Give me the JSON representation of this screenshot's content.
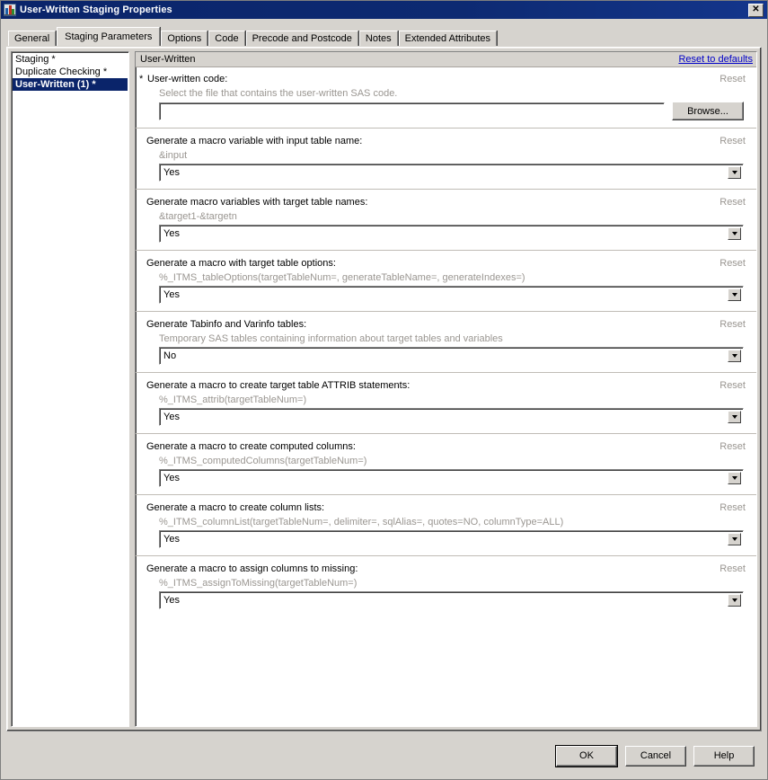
{
  "window": {
    "title": "User-Written Staging Properties",
    "icon": "application-window-icon",
    "close_label": "✕"
  },
  "tabs": [
    {
      "label": "General",
      "selected": false
    },
    {
      "label": "Staging Parameters",
      "selected": true
    },
    {
      "label": "Options",
      "selected": false
    },
    {
      "label": "Code",
      "selected": false
    },
    {
      "label": "Precode and Postcode",
      "selected": false
    },
    {
      "label": "Notes",
      "selected": false
    },
    {
      "label": "Extended Attributes",
      "selected": false
    }
  ],
  "left_list": [
    {
      "label": "Staging *",
      "selected": false
    },
    {
      "label": "Duplicate Checking *",
      "selected": false
    },
    {
      "label": "User-Written (1) *",
      "selected": true
    }
  ],
  "panel": {
    "title": "User-Written",
    "reset_to_defaults": "Reset to defaults",
    "reset_label": "Reset"
  },
  "sections": [
    {
      "type": "file",
      "required": true,
      "star": "*",
      "label": "User-written code:",
      "reset": "Reset",
      "hint": "Select the file that contains the user-written SAS code.",
      "value": "",
      "placeholder": "",
      "browse_label": "Browse..."
    },
    {
      "type": "combo",
      "required": false,
      "label": "Generate a macro variable with input table name:",
      "reset": "Reset",
      "hint": "&input",
      "value": "Yes"
    },
    {
      "type": "combo",
      "required": false,
      "label": "Generate macro variables with target table names:",
      "reset": "Reset",
      "hint": "&target1-&targetn",
      "value": "Yes"
    },
    {
      "type": "combo",
      "required": false,
      "label": "Generate a macro with target table options:",
      "reset": "Reset",
      "hint": "%_ITMS_tableOptions(targetTableNum=, generateTableName=, generateIndexes=)",
      "value": "Yes"
    },
    {
      "type": "combo",
      "required": false,
      "label": "Generate Tabinfo and Varinfo tables:",
      "reset": "Reset",
      "hint": "Temporary SAS tables containing information about target tables and variables",
      "value": "No"
    },
    {
      "type": "combo",
      "required": false,
      "label": "Generate a macro to create target table ATTRIB statements:",
      "reset": "Reset",
      "hint": "%_ITMS_attrib(targetTableNum=)",
      "value": "Yes"
    },
    {
      "type": "combo",
      "required": false,
      "label": "Generate a macro to create computed columns:",
      "reset": "Reset",
      "hint": "%_ITMS_computedColumns(targetTableNum=)",
      "value": "Yes"
    },
    {
      "type": "combo",
      "required": false,
      "label": "Generate a macro to create column lists:",
      "reset": "Reset",
      "hint": "%_ITMS_columnList(targetTableNum=, delimiter=, sqlAlias=, quotes=NO, columnType=ALL)",
      "value": "Yes"
    },
    {
      "type": "combo",
      "required": false,
      "label": "Generate a macro to assign columns to missing:",
      "reset": "Reset",
      "hint": "%_ITMS_assignToMissing(targetTableNum=)",
      "value": "Yes"
    }
  ],
  "footer": {
    "ok": "OK",
    "cancel": "Cancel",
    "help": "Help"
  },
  "colors": {
    "titlebar": "#0a246a",
    "dialog_face": "#d6d3ce",
    "link": "#0000c8",
    "muted_text": "#9a9691",
    "selection": "#0a246a"
  }
}
